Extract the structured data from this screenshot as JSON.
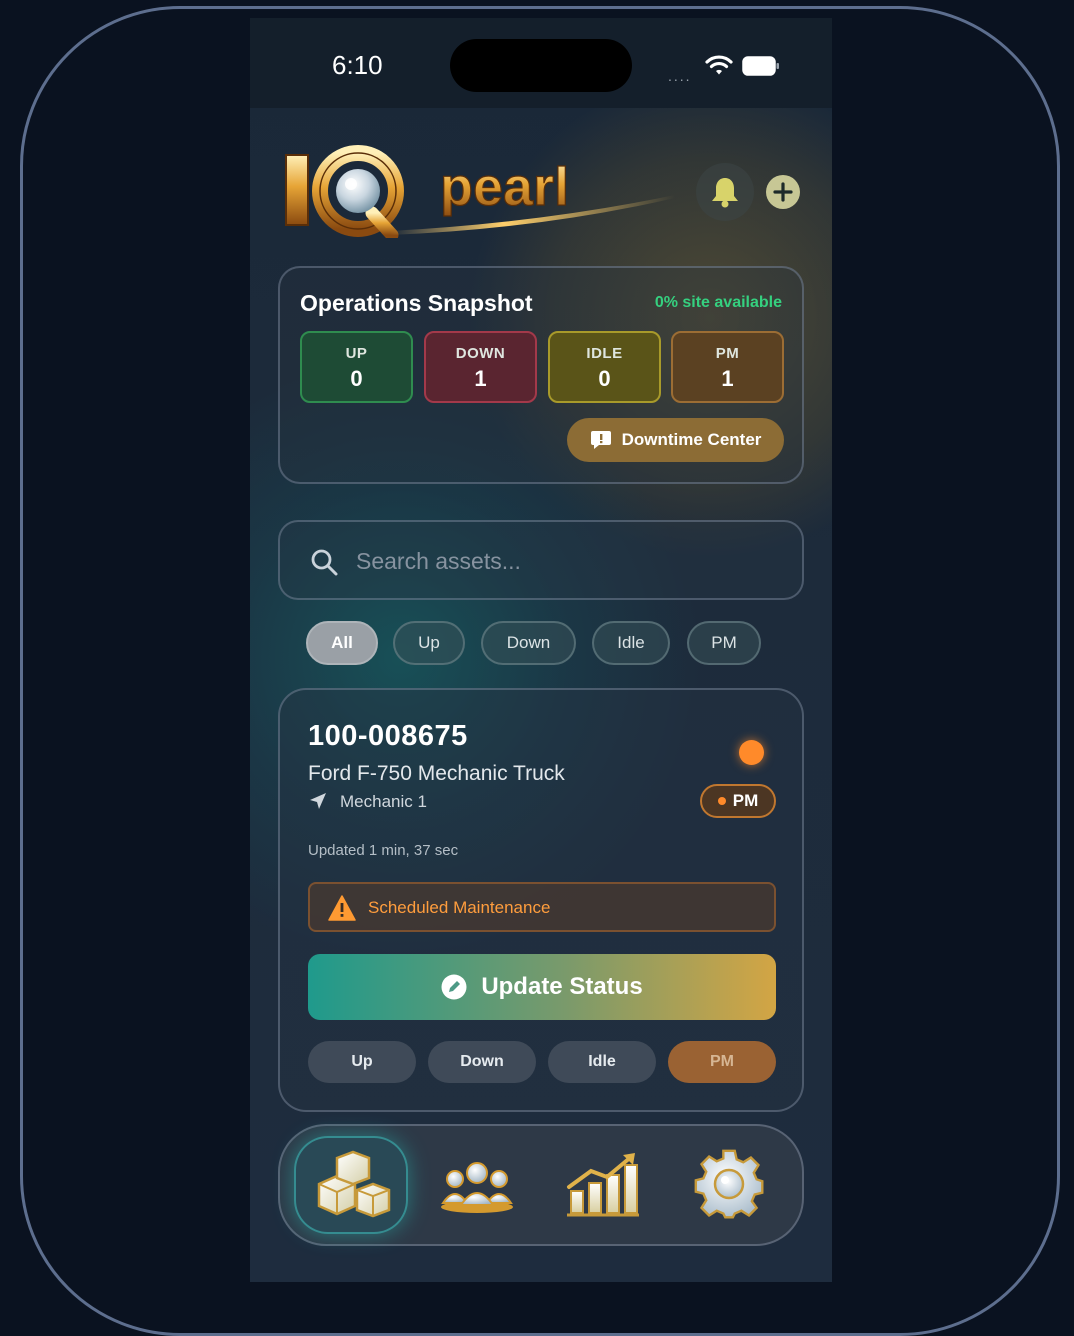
{
  "status_bar": {
    "time": "6:10",
    "signal": "...."
  },
  "header": {
    "logo_text": "IQpearl"
  },
  "snapshot": {
    "title": "Operations Snapshot",
    "site_available": "0% site available",
    "stats": [
      {
        "label": "UP",
        "value": "0",
        "color": "#2f8c4f"
      },
      {
        "label": "DOWN",
        "value": "1",
        "color": "#a3394a"
      },
      {
        "label": "IDLE",
        "value": "0",
        "color": "#a89a2a"
      },
      {
        "label": "PM",
        "value": "1",
        "color": "#9c6d34"
      }
    ],
    "downtime_button": "Downtime Center"
  },
  "search": {
    "placeholder": "Search assets...",
    "value": ""
  },
  "filters": [
    "All",
    "Up",
    "Down",
    "Idle",
    "PM"
  ],
  "filters_selected": "All",
  "asset": {
    "id": "100-008675",
    "name": "Ford F-750 Mechanic Truck",
    "location": "Mechanic 1",
    "status": "PM",
    "status_color": "#ff8a2a",
    "updated": "Updated 1 min, 37 sec",
    "alert": "Scheduled Maintenance",
    "update_button": "Update Status",
    "quick_status": [
      "Up",
      "Down",
      "Idle",
      "PM"
    ],
    "quick_selected": "PM"
  },
  "tabbar": {
    "tabs": [
      {
        "icon": "assets-cubes-icon",
        "active": true
      },
      {
        "icon": "team-icon",
        "active": false
      },
      {
        "icon": "analytics-chart-icon",
        "active": false
      },
      {
        "icon": "settings-gear-icon",
        "active": false
      }
    ]
  },
  "colors": {
    "accent_teal": "#1f9a8c",
    "accent_gold": "#d3a544",
    "available_green": "#35d07f"
  }
}
